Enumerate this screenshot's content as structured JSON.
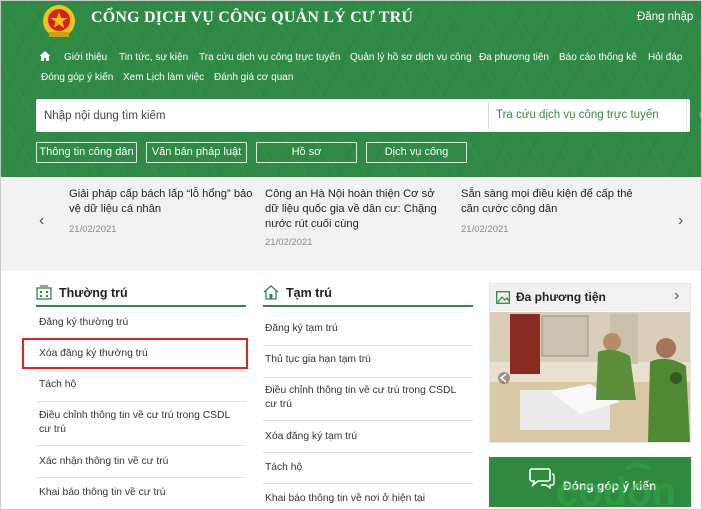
{
  "header": {
    "site_title": "CỔNG DỊCH VỤ CÔNG QUẢN LÝ CƯ TRÚ",
    "login_label": "Đăng nhập"
  },
  "nav": {
    "items": [
      "Giới thiệu",
      "Tin tức, sự kiện",
      "Tra cứu dịch vụ công trực tuyến",
      "Quản lý hồ sơ dịch vụ công",
      "Đa phương tiện",
      "Báo cáo thống kê",
      "Hỏi đáp",
      "Đóng góp ý kiến",
      "Xem Lịch làm việc",
      "Đánh giá cơ quan"
    ]
  },
  "search": {
    "placeholder": "Nhập nội dung tìm kiếm",
    "service_label": "Tra cứu dịch vụ công trực tuyến"
  },
  "quick_buttons": [
    "Thông tin công dân",
    "Văn bản pháp luật",
    "Hồ sơ",
    "Dịch vụ công"
  ],
  "news": [
    {
      "title": "Giải pháp cấp bách lấp “lỗ hổng” bảo vệ dữ liệu cá nhân",
      "date": "21/02/2021"
    },
    {
      "title": "Công an Hà Nội hoàn thiện Cơ sở dữ liệu quốc gia về dân cư: Chặng nước rút cuối cùng",
      "date": "21/02/2021"
    },
    {
      "title": "Sẵn sàng mọi điều kiện để cấp thẻ căn cước công dân",
      "date": "21/02/2021"
    }
  ],
  "thuong_tru": {
    "heading": "Thường trú",
    "items": [
      "Đăng ký thường trú",
      "Xóa đăng ký thường trú",
      "Tách hộ",
      "Điều chỉnh thông tin về cư trú trong CSDL cư trú",
      "Xác nhận thông tin về cư trú",
      "Khai báo thông tin về cư trú"
    ]
  },
  "tam_tru": {
    "heading": "Tạm trú",
    "items": [
      "Đăng ký tạm trú",
      "Thủ tục gia hạn tạm trú",
      "Điều chỉnh thông tin về cư trú trong CSDL cư trú",
      "Xóa đăng ký tạm trú",
      "Tách hộ",
      "Khai báo thông tin về nơi ở hiện tại"
    ]
  },
  "media": {
    "heading": "Đa phương tiện"
  },
  "feedback": {
    "label": "Đóng góp ý kiến"
  },
  "colors": {
    "brand_green": "#2f8a45",
    "highlight_red": "#e02424"
  }
}
